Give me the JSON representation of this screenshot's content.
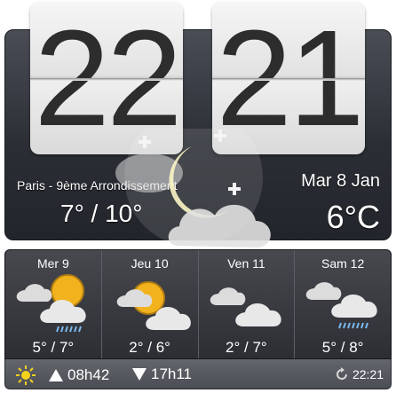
{
  "clock": {
    "hour": "22",
    "minute": "21"
  },
  "current": {
    "location": "Paris - 9ème Arrondissement",
    "temp_range": "7° / 10°",
    "date": "Mar 8 Jan",
    "temperature": "6°C",
    "condition_icon": "moon-cloud-icon"
  },
  "forecast": [
    {
      "day": "Mer 9",
      "range": "5° / 7°",
      "icon": "sun-cloud-rain-icon"
    },
    {
      "day": "Jeu 10",
      "range": "2° / 6°",
      "icon": "sun-cloud-icon"
    },
    {
      "day": "Ven 11",
      "range": "2° / 7°",
      "icon": "cloudy-icon"
    },
    {
      "day": "Sam 12",
      "range": "5° / 8°",
      "icon": "cloud-rain-icon"
    }
  ],
  "status_bar": {
    "sunrise": "08h42",
    "sunset": "17h11",
    "updated": "22:21"
  },
  "colors": {
    "sun": "#f2b21e",
    "panel": "#2b2e35",
    "bar": "#55585e"
  }
}
